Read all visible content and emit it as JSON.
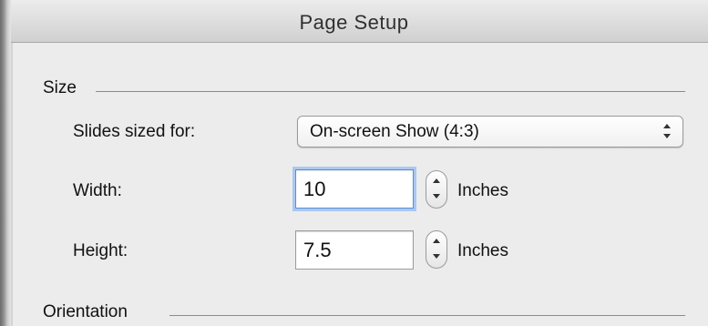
{
  "window": {
    "title": "Page Setup"
  },
  "sections": {
    "size": "Size",
    "orientation": "Orientation"
  },
  "slides_sized_for": {
    "label": "Slides sized for:",
    "selected": "On-screen Show (4:3)"
  },
  "width": {
    "label": "Width:",
    "value": "10",
    "units": "Inches"
  },
  "height": {
    "label": "Height:",
    "value": "7.5",
    "units": "Inches"
  },
  "icons": {
    "popup": "updown-arrows-icon",
    "stepper_up": "chevron-up-icon",
    "stepper_down": "chevron-down-icon"
  },
  "colors": {
    "focus_ring": "#a9c8f2",
    "focus_border": "#5b8fd8"
  }
}
